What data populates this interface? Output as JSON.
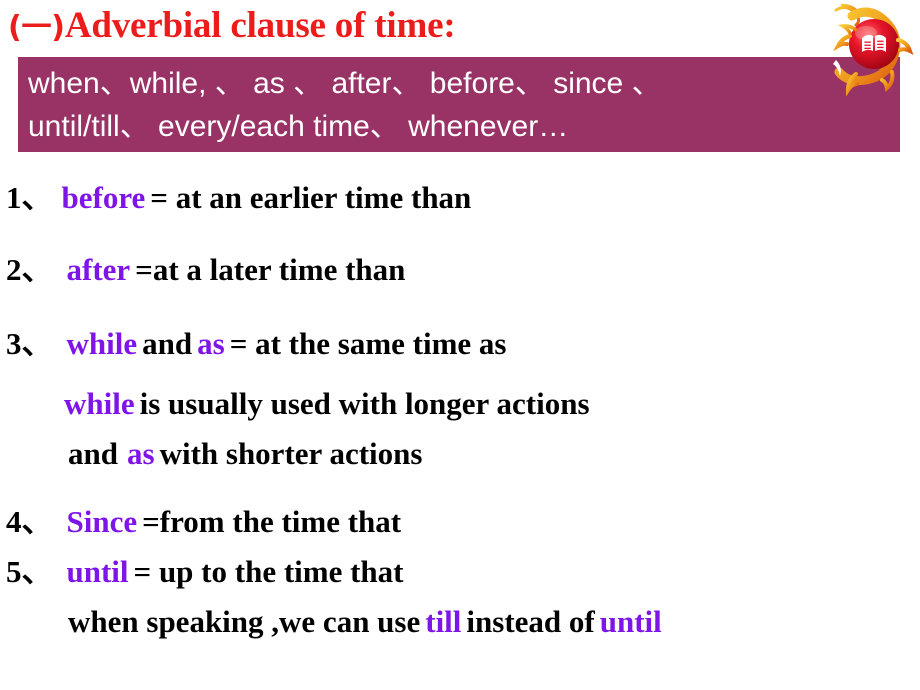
{
  "slide": {
    "title_prefix": "(一)",
    "title": "Adverbial clause of time:",
    "colors": {
      "title_red": "#ED1C1C",
      "banner_purple": "#993366",
      "keyword_violet": "#7F14E8",
      "body_black": "#000000",
      "banner_text_white": "#FFFFFF"
    }
  },
  "banner": {
    "line1": "when、while, 、 as 、 after、 before、 since 、",
    "line2": "until/till、 every/each time、 whenever…"
  },
  "emblem": {
    "name": "golden-dragon-red-globe-book-logo"
  },
  "list": [
    {
      "number": "1、",
      "keyword": "before",
      "definition": "= at an earlier time than"
    },
    {
      "number": "2、",
      "keyword": "after",
      "definition": "=at a later time than"
    },
    {
      "number": "3、",
      "keyword": "while",
      "connector": "and",
      "keyword2": "as",
      "definition": "= at the same time as",
      "sub_lines": [
        {
          "keyword": "while",
          "text": "is usually used with longer actions"
        },
        {
          "prefix": "and",
          "keyword": "as",
          "text": "with shorter actions"
        }
      ]
    },
    {
      "number": "4、",
      "keyword": "Since",
      "definition": "=from the time that"
    },
    {
      "number": "5、",
      "keyword": "until",
      "definition": "= up to the time that",
      "sub_lines": [
        {
          "text_before": "when speaking ,we can use",
          "keyword": "till",
          "text_middle": "instead of",
          "keyword2": "until"
        }
      ]
    }
  ]
}
